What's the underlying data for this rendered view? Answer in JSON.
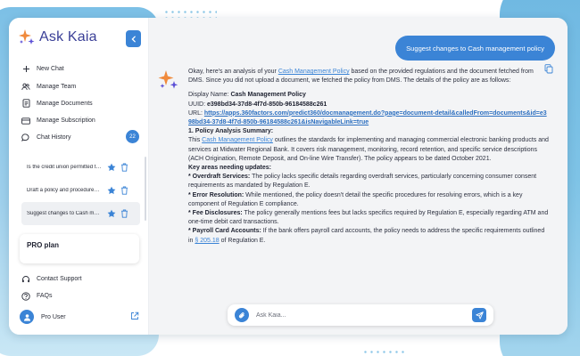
{
  "brand": {
    "name": "Ask Kaia"
  },
  "nav": [
    {
      "label": "New Chat",
      "icon": "plus-icon"
    },
    {
      "label": "Manage Team",
      "icon": "team-icon"
    },
    {
      "label": "Manage Documents",
      "icon": "document-icon"
    },
    {
      "label": "Manage Subscription",
      "icon": "card-icon"
    }
  ],
  "chat_history": {
    "label": "Chat History",
    "count": "22"
  },
  "history": [
    {
      "title": "Is the credit union permitted to ...",
      "active": false
    },
    {
      "title": "Draft a policy and procedures ...",
      "active": false
    },
    {
      "title": "Suggest changes to Cash management ...",
      "active": true
    }
  ],
  "plan": {
    "label": "PRO plan"
  },
  "footer": [
    {
      "label": "Contact Support",
      "icon": "headset-icon"
    },
    {
      "label": "FAQs",
      "icon": "help-icon"
    }
  ],
  "user": {
    "name": "Pro User"
  },
  "conversation": {
    "user_message": "Suggest changes to Cash management policy",
    "reply": {
      "intro_pre": "Okay, here's an analysis of your ",
      "intro_link": "Cash Management Policy",
      "intro_post": " based on the provided regulations and the document fetched from DMS. Since you did not upload a document, we fetched the policy from DMS. The details of the policy are as follows:",
      "display_label": "Display Name: ",
      "display_value": "Cash Management Policy",
      "uuid_label": "UUID: ",
      "uuid_value": "e398bd34-37d8-4f7d-850b-96184588c261",
      "url_label": "URL: ",
      "url_value": "https://apps.360factors.com/predict360/docmanagement.do?page=document-detail&calledFrom=documents&id=e398bd34-37d8-4f7d-850b-96184588c261&isNavigableLink=true",
      "section1": "1. Policy Analysis Summary:",
      "summary_pre": "This ",
      "summary_link": "Cash Management Policy",
      "summary_post": " outlines the standards for implementing and managing commercial electronic banking products and services at Midwater Regional Bank. It covers risk management, monitoring, record retention, and specific service descriptions (ACH Origination, Remote Deposit, and On-line Wire Transfer). The policy appears to be dated October 2021.",
      "key_areas": "Key areas needing updates:",
      "b1_label": "* Overdraft Services:",
      "b1_text": " The policy lacks specific details regarding overdraft services, particularly concerning consumer consent requirements as mandated by Regulation E.",
      "b2_label": "* Error Resolution:",
      "b2_text": " While mentioned, the policy doesn't detail the specific procedures for resolving errors, which is a key component of Regulation E compliance.",
      "b3_label": "* Fee Disclosures:",
      "b3_text": " The policy generally mentions fees but lacks specifics required by Regulation E, especially regarding ATM and one-time debit card transactions.",
      "b4_label": "* Payroll Card Accounts:",
      "b4_text_pre": " If the bank offers payroll card accounts, the policy needs to address the specific requirements outlined in ",
      "b4_link": "§ 205.18",
      "b4_text_post": " of Regulation E."
    }
  },
  "composer": {
    "placeholder": "Ask Kaia..."
  },
  "colors": {
    "accent": "#3b84d6",
    "brand_text": "#3a3f97",
    "sparkle_orange": "#f08a3c",
    "sparkle_purple": "#5b4fd6"
  }
}
